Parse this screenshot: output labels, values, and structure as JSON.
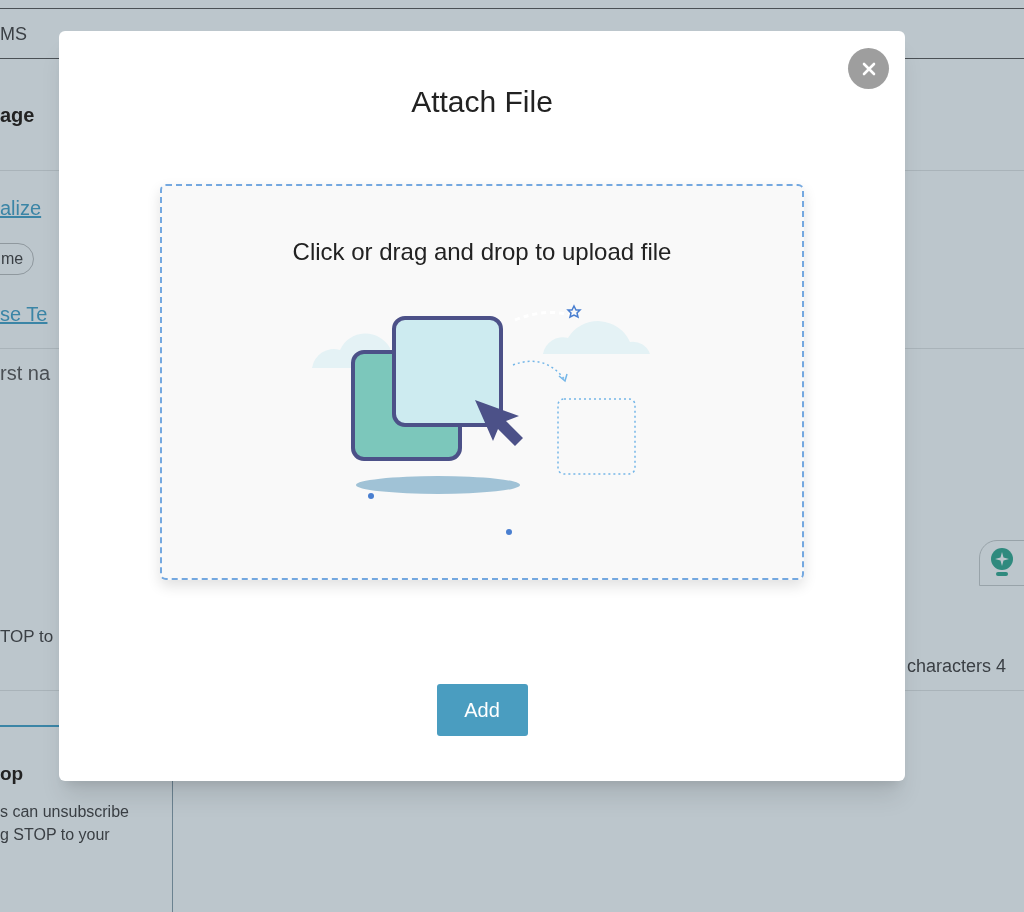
{
  "background": {
    "tab": "MS",
    "heading": "age",
    "link_1": "alize",
    "chip": "me",
    "link_2": "se Te",
    "text_1": "rst na",
    "text_2": "TOP to",
    "card_title": "op",
    "card_lines": [
      "s can unsubscribe",
      "g STOP to your"
    ],
    "counter": "characters 4"
  },
  "modal": {
    "title": "Attach File",
    "dropzone_text": "Click or drag and drop to upload file",
    "button": "Add"
  }
}
